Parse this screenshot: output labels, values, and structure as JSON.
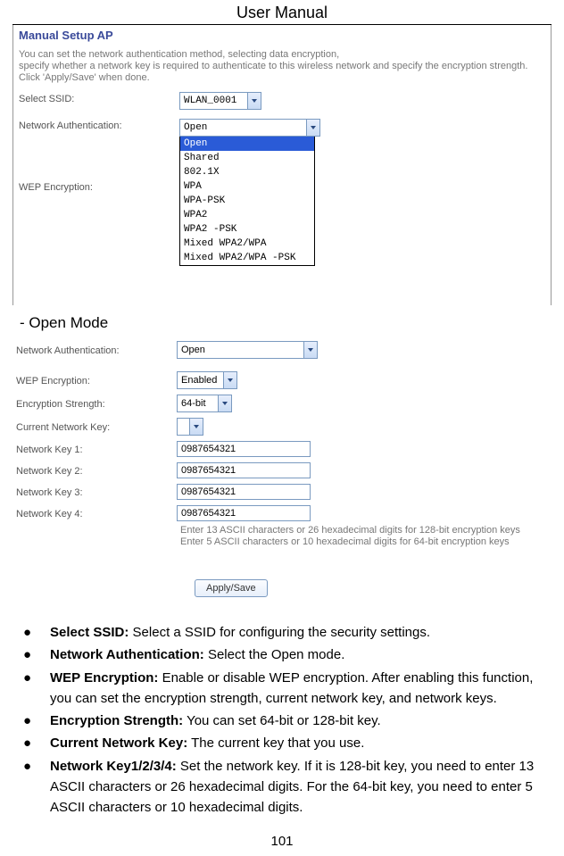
{
  "header": "User Manual",
  "shot1": {
    "title": "Manual Setup AP",
    "intro1": "You can set the network authentication method, selecting data encryption,",
    "intro2": "specify whether a network key is required to authenticate to this wireless network and specify the encryption strength.",
    "intro3": "Click 'Apply/Save' when done.",
    "ssid_label": "Select SSID:",
    "ssid_value": "WLAN_0001",
    "auth_label": "Network Authentication:",
    "auth_value": "Open",
    "wep_label": "WEP Encryption:",
    "options": [
      "Open",
      "Shared",
      "802.1X",
      "WPA",
      "WPA-PSK",
      "WPA2",
      "WPA2 -PSK",
      "Mixed WPA2/WPA",
      "Mixed WPA2/WPA -PSK"
    ]
  },
  "open_mode_label": "-  Open Mode",
  "shot2": {
    "auth_label": "Network Authentication:",
    "auth_value": "Open",
    "wep_label": "WEP Encryption:",
    "wep_value": "Enabled",
    "strength_label": "Encryption Strength:",
    "strength_value": "64-bit",
    "current_label": "Current Network Key:",
    "k1_label": "Network Key 1:",
    "k2_label": "Network Key 2:",
    "k3_label": "Network Key 3:",
    "k4_label": "Network Key 4:",
    "key_value": "0987654321",
    "hint1": "Enter 13 ASCII characters or 26 hexadecimal digits for 128-bit encryption keys",
    "hint2": "Enter 5 ASCII characters or 10 hexadecimal digits for 64-bit encryption keys",
    "apply": "Apply/Save"
  },
  "bullets": {
    "items": [
      {
        "bold": "Select SSID:",
        "text": " Select a SSID for configuring the security settings."
      },
      {
        "bold": "Network Authentication:",
        "text": " Select the Open mode."
      },
      {
        "bold": "WEP Encryption:",
        "text": " Enable or disable WEP encryption. After enabling this function, you can set the encryption strength, current network key, and network keys."
      },
      {
        "bold": "Encryption Strength:",
        "text": " You can set 64-bit or 128-bit key."
      },
      {
        "bold": "Current Network Key:",
        "text": " The current key that you use."
      },
      {
        "bold": "Network Key1/2/3/4:",
        "text": " Set the network key. If it is 128-bit key, you need to enter 13 ASCII characters or 26 hexadecimal digits. For the 64-bit key, you need to enter 5 ASCII characters or 10 hexadecimal digits."
      }
    ]
  },
  "page_number": "101"
}
